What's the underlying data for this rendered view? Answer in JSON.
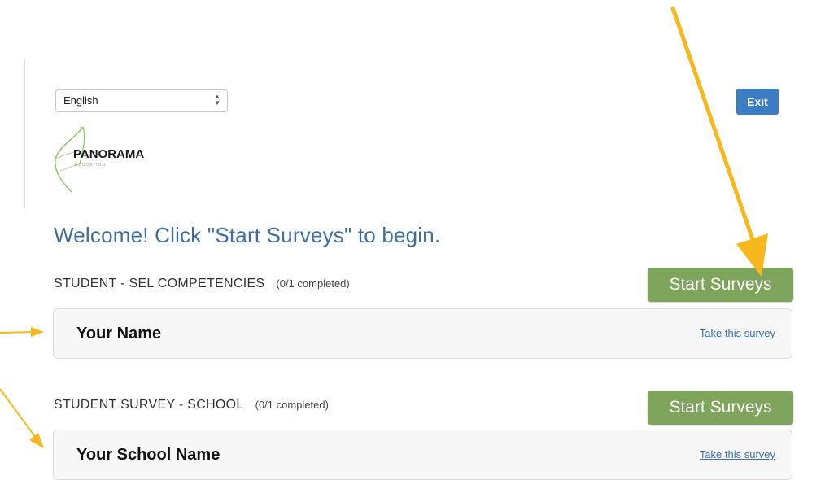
{
  "header": {
    "language_select": {
      "value": "English",
      "caret": "▲▼"
    },
    "exit_label": "Exit",
    "logo_text": "PANORAMA",
    "logo_subtext": "EDUCATION"
  },
  "welcome": "Welcome! Click \"Start Surveys\" to begin.",
  "surveys": [
    {
      "title": "STUDENT - SEL COMPETENCIES",
      "progress": "(0/1 completed)",
      "start_label": "Start Surveys",
      "card_name": "Your Name",
      "take_label": "Take this survey"
    },
    {
      "title": "STUDENT SURVEY - SCHOOL",
      "progress": "(0/1 completed)",
      "start_label": "Start Surveys",
      "card_name": "Your School Name",
      "take_label": "Take this survey"
    }
  ],
  "colors": {
    "start_button": "#7fa55c",
    "exit_button": "#3b7dc4",
    "welcome_text": "#3d6e9f",
    "annotation_arrow": "#f6b81c"
  }
}
